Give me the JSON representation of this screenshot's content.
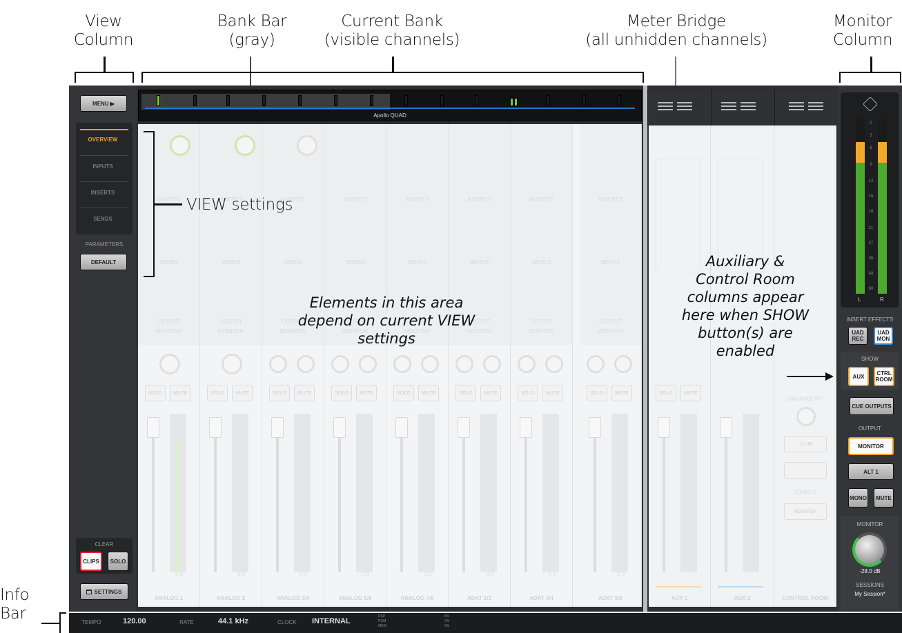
{
  "annotations": {
    "view_column": [
      "View",
      "Column"
    ],
    "bank_bar": [
      "Bank Bar",
      "(gray)"
    ],
    "current_bank": [
      "Current Bank",
      "(visible channels)"
    ],
    "meter_bridge": [
      "Meter Bridge",
      "(all unhidden channels)"
    ],
    "monitor_column": [
      "Monitor",
      "Column"
    ],
    "info_bar": [
      "Info",
      "Bar"
    ],
    "view_settings": "VIEW settings",
    "elements_note": [
      "Elements in this area",
      "depend on current VIEW",
      "settings"
    ],
    "aux_note": [
      "Auxiliary &",
      "Control Room",
      "columns appear",
      "here when SHOW",
      "button(s) are",
      "enabled"
    ]
  },
  "view_column": {
    "menu": "MENU ▶",
    "tabs": [
      "OVERVIEW",
      "INPUTS",
      "INSERTS",
      "SENDS"
    ],
    "parameters_label": "PARAMETERS",
    "default": "DEFAULT",
    "clear_label": "CLEAR",
    "clips": "CLIPS",
    "solo": "SOLO",
    "settings": "SETTINGS"
  },
  "bank": {
    "device_name": "Apollo QUAD"
  },
  "channels": [
    "ANALOG 1",
    "ANALOG 2",
    "ANALOG 3/4",
    "ANALOG 5/6",
    "ANALOG 7/8",
    "ADAT 1/2",
    "ADAT 3/4",
    "ADAT 5/6"
  ],
  "strip_labels": {
    "inserts": "INSERTS",
    "sends": "SENDS",
    "output": "OUTPUT",
    "monitor": "MONITOR",
    "solo": "SOLO",
    "mute": "MUTE",
    "fader_value": "0.0"
  },
  "aux": {
    "strips": [
      "AUX 1",
      "AUX 2",
      "CONTROL ROOM"
    ],
    "dim_amount": "DIM AMOUNT",
    "dim_value": "-10 dB",
    "source": "SOURCE",
    "source_value": "MONITOR"
  },
  "monitor_column": {
    "meter_scale": [
      "0",
      "3",
      "6",
      "9",
      "12",
      "15",
      "18",
      "21",
      "27",
      "36",
      "48",
      "60"
    ],
    "l": "L",
    "r": "R",
    "insert_effects": "INSERT EFFECTS",
    "uad_rec": "UAD REC",
    "uad_mon": "UAD MON",
    "show": "SHOW",
    "aux": "AUX",
    "ctrl_room": "CTRL ROOM",
    "cue_outputs": "CUE OUTPUTS",
    "output": "OUTPUT",
    "monitor_btn": "MONITOR",
    "alt1": "ALT 1",
    "mono": "MONO",
    "mute": "MUTE",
    "monitor_label": "MONITOR",
    "monitor_level": "-28.0 dB",
    "sessions": "SESSIONS",
    "session_name": "My Session*"
  },
  "info_bar": {
    "tempo_label": "TEMPO",
    "tempo": "120.00",
    "rate_label": "RATE",
    "rate": "44.1 kHz",
    "clock_label": "CLOCK",
    "clock": "INTERNAL",
    "dsp": "DSP",
    "pgm": "PGM",
    "mem": "MEM",
    "dsp_pct": "8%",
    "pgm_pct": "2%",
    "mem_pct": "0%"
  },
  "colors": {
    "accent_orange": "#f0a020",
    "accent_blue": "#2b8fe0",
    "meter_green": "#4caa2e",
    "clips_red": "#e02030"
  }
}
